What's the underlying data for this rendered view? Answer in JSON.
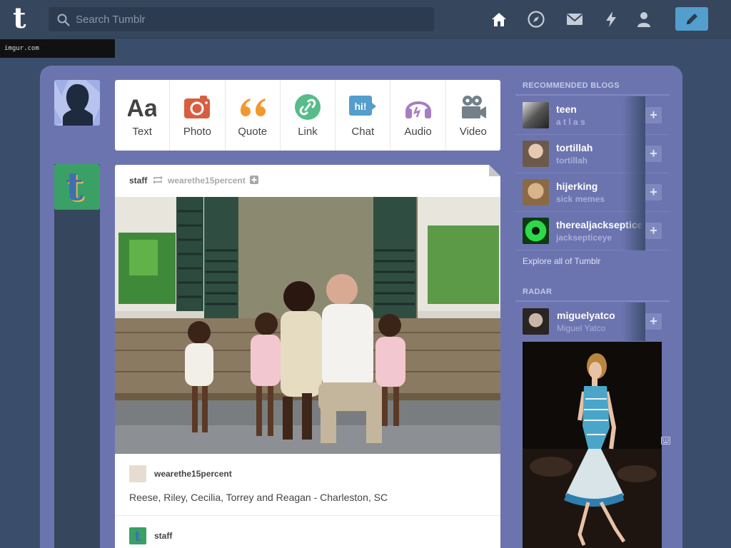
{
  "header": {
    "logo": "t",
    "search_placeholder": "Search Tumblr",
    "nav": [
      "home-icon",
      "explore-compass-icon",
      "inbox-envelope-icon",
      "activity-lightning-icon",
      "account-person-icon"
    ],
    "compose_icon": "pencil-icon"
  },
  "overlay": {
    "watermark": "imgur.com"
  },
  "post_types": [
    {
      "label": "Text",
      "icon": "text-aa-icon",
      "color": "#444444"
    },
    {
      "label": "Photo",
      "icon": "camera-icon",
      "color": "#d95e40"
    },
    {
      "label": "Quote",
      "icon": "quote-icon",
      "color": "#f2992e"
    },
    {
      "label": "Link",
      "icon": "link-icon",
      "color": "#56bc8a"
    },
    {
      "label": "Chat",
      "icon": "chat-bubble-icon",
      "color": "#529ecc",
      "badge": "hi!"
    },
    {
      "label": "Audio",
      "icon": "headphones-icon",
      "color": "#a77dc2"
    },
    {
      "label": "Video",
      "icon": "video-camera-icon",
      "color": "#748089"
    }
  ],
  "post": {
    "author": "staff",
    "reblogged_from": "wearethe15percent",
    "source_name": "wearethe15percent",
    "caption": "Reese, Riley, Cecilia, Torrey and Reagan - Charleston, SC",
    "next_source_name": "staff"
  },
  "sidebar": {
    "recommended_title": "RECOMMENDED BLOGS",
    "blogs": [
      {
        "name": "teen",
        "subtitle": "a t l a s"
      },
      {
        "name": "tortillah",
        "subtitle": "tortillah"
      },
      {
        "name": "hijerking",
        "subtitle": "sick memes"
      },
      {
        "name": "therealjacksepticeye",
        "subtitle": "jacksepticeye"
      }
    ],
    "explore_link": "Explore all of Tumblr",
    "radar_title": "RADAR",
    "radar": {
      "name": "miguelyatco",
      "subtitle": "Miguel Yatco"
    }
  },
  "colors": {
    "header_bg": "#36465d",
    "page_bg": "#3a4e6b",
    "dashboard_bg": "#6c74b0",
    "compose_button": "#529ecc"
  }
}
